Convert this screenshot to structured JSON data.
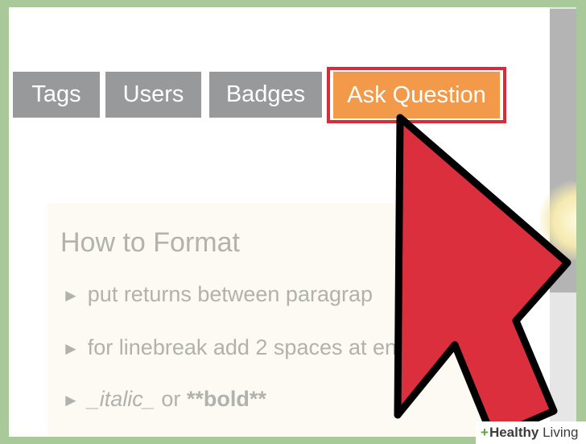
{
  "nav": {
    "tags_label": "Tags",
    "users_label": "Users",
    "badges_label": "Badges",
    "ask_label": "Ask Question"
  },
  "format_help": {
    "title": "How to Format",
    "line1": "put returns between paragrap",
    "line2": "for linebreak add 2 spaces at end",
    "line3_italic": "_italic_",
    "line3_or": "or",
    "line3_bold": "**bold**",
    "bullet_glyph": "►"
  },
  "watermark": {
    "plus": "+",
    "healthy": "Healthy",
    "living": "Living"
  },
  "colors": {
    "nav_button": "#98999a",
    "ask_button": "#f39a4a",
    "highlight_outline": "#d92b3a",
    "cursor_fill": "#dc2f3e",
    "background": "#a9c99a"
  },
  "icons": {
    "cursor": "mouse-pointer-arrow-icon",
    "bullet": "right-triangle-icon"
  }
}
